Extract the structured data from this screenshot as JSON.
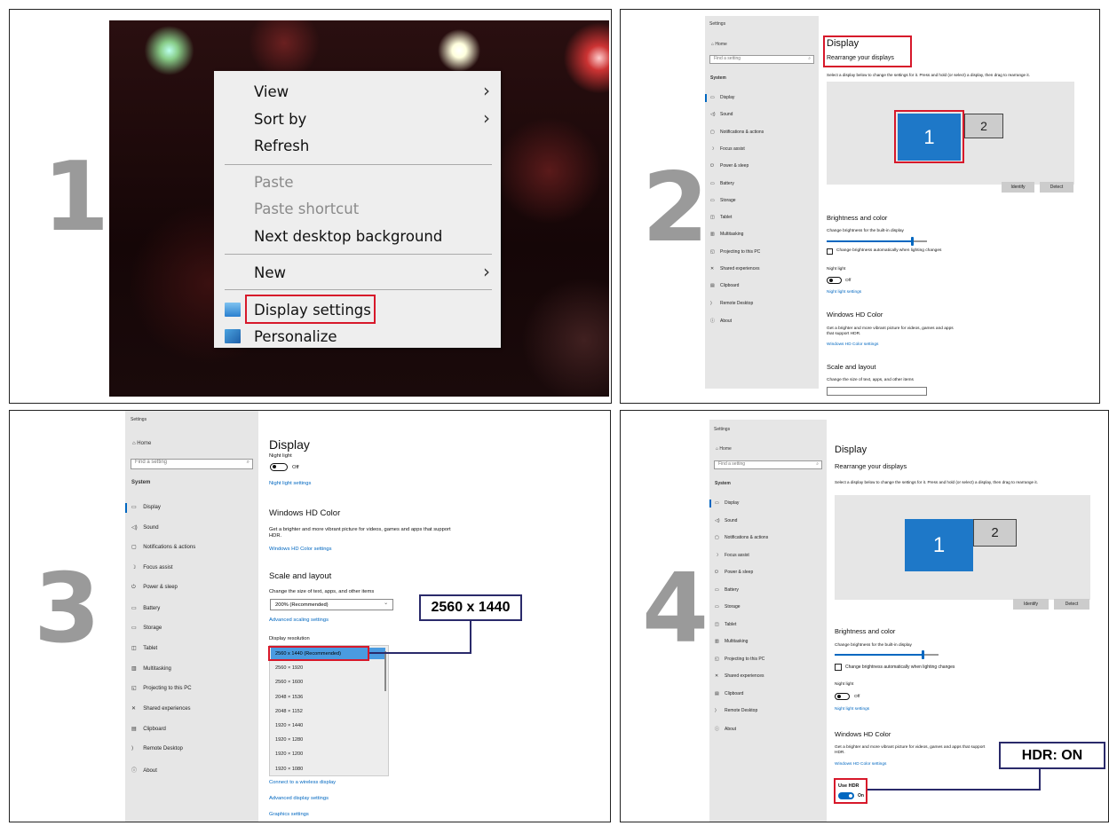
{
  "steps": [
    "1",
    "2",
    "3",
    "4"
  ],
  "step1": {
    "menu_items": [
      {
        "label": "View",
        "submenu": true,
        "disabled": false
      },
      {
        "label": "Sort by",
        "submenu": true,
        "disabled": false
      },
      {
        "label": "Refresh",
        "submenu": false,
        "disabled": false
      },
      {
        "label": "Paste",
        "submenu": false,
        "disabled": true
      },
      {
        "label": "Paste shortcut",
        "submenu": false,
        "disabled": true
      },
      {
        "label": "Next desktop background",
        "submenu": false,
        "disabled": false
      },
      {
        "label": "New",
        "submenu": true,
        "disabled": false
      },
      {
        "label": "Display settings",
        "submenu": false,
        "disabled": false
      },
      {
        "label": "Personalize",
        "submenu": false,
        "disabled": false
      }
    ]
  },
  "settings_common": {
    "window_title": "Settings",
    "home": "Home",
    "search_placeholder": "Find a setting",
    "section": "System",
    "nav": [
      {
        "icon": "display-icon",
        "glyph": "▭",
        "label": "Display"
      },
      {
        "icon": "sound-icon",
        "glyph": "◁)",
        "label": "Sound"
      },
      {
        "icon": "notifications-icon",
        "glyph": "▢",
        "label": "Notifications & actions"
      },
      {
        "icon": "focus-assist-icon",
        "glyph": "☽",
        "label": "Focus assist"
      },
      {
        "icon": "power-icon",
        "glyph": "⏻",
        "label": "Power & sleep"
      },
      {
        "icon": "battery-icon",
        "glyph": "▭",
        "label": "Battery"
      },
      {
        "icon": "storage-icon",
        "glyph": "▭",
        "label": "Storage"
      },
      {
        "icon": "tablet-icon",
        "glyph": "◫",
        "label": "Tablet"
      },
      {
        "icon": "multitasking-icon",
        "glyph": "▥",
        "label": "Multitasking"
      },
      {
        "icon": "projecting-icon",
        "glyph": "◱",
        "label": "Projecting to this PC"
      },
      {
        "icon": "shared-experiences-icon",
        "glyph": "✕",
        "label": "Shared experiences"
      },
      {
        "icon": "clipboard-icon",
        "glyph": "▤",
        "label": "Clipboard"
      },
      {
        "icon": "remote-desktop-icon",
        "glyph": "⟩",
        "label": "Remote Desktop"
      },
      {
        "icon": "about-icon",
        "glyph": "ⓘ",
        "label": "About"
      }
    ]
  },
  "display": {
    "title": "Display",
    "rearrange": "Rearrange your displays",
    "rearrange_desc": "Select a display below to change the settings for it. Press and hold (or select) a display, then drag to rearrange it.",
    "monitor1": "1",
    "monitor2": "2",
    "identify": "Identify",
    "detect": "Detect",
    "brightness_heading": "Brightness and color",
    "brightness_label": "Change brightness for the built-in display",
    "brightness_level": 0.85,
    "brightness_auto": "Change brightness automatically when lighting changes",
    "night_light": "Night light",
    "off": "Off",
    "on": "On",
    "night_light_settings": "Night light settings",
    "hd_color_heading": "Windows HD Color",
    "hd_color_desc": "Get a brighter and more vibrant picture for videos, games and apps that support HDR.",
    "hd_color_link": "Windows HD Color settings",
    "scale_heading": "Scale and layout",
    "scale_label": "Change the size of text, apps, and other items",
    "scale_value": "200% (Recommended)",
    "advanced_scaling": "Advanced scaling settings",
    "resolution_label": "Display resolution",
    "resolutions": [
      "2560 x 1440  (Recommended)",
      "2560 × 1920",
      "2560 × 1600",
      "2048 × 1536",
      "2048 × 1152",
      "1920 × 1440",
      "1920 × 1280",
      "1920 × 1200",
      "1920 × 1080"
    ],
    "connect_wireless": "Connect to a wireless display",
    "advanced_display": "Advanced display settings",
    "graphics": "Graphics settings",
    "use_hdr": "Use HDR"
  },
  "callouts": {
    "resolution": "2560 x 1440",
    "hdr": "HDR: ON"
  },
  "colors": {
    "accent": "#0067c0",
    "highlight": "#d7182a",
    "monitor_selected": "#1e78c8",
    "callout_border": "#2a2a6a",
    "step_number": "#9a9a9a"
  }
}
